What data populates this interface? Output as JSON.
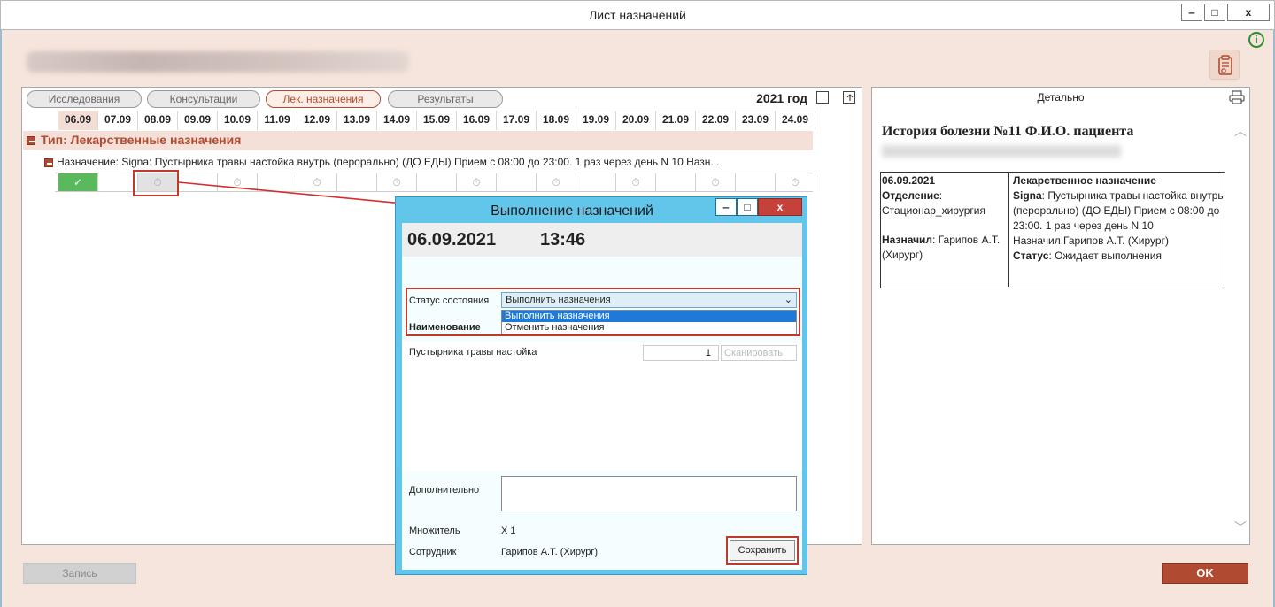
{
  "window": {
    "title": "Лист назначений",
    "controls": {
      "minimize": "‒",
      "maximize": "□",
      "close": "x"
    }
  },
  "tabs": [
    {
      "label": "Исследования",
      "active": false
    },
    {
      "label": "Консультации",
      "active": false
    },
    {
      "label": "Лек. назначения",
      "active": true
    },
    {
      "label": "Результаты",
      "active": false
    }
  ],
  "year_label": "2021 год",
  "dates": [
    "06.09",
    "07.09",
    "08.09",
    "09.09",
    "10.09",
    "11.09",
    "12.09",
    "13.09",
    "14.09",
    "15.09",
    "16.09",
    "17.09",
    "18.09",
    "19.09",
    "20.09",
    "21.09",
    "22.09",
    "23.09",
    "24.09"
  ],
  "selected_date": "06.09",
  "type_group": {
    "label": "Тип: Лекарственные назначения"
  },
  "assignment": {
    "text": "Назначение: Signa: Пустырника травы настойка  внутрь (перорально) (ДО ЕДЫ)   Прием с 08:00 до 23:00. 1 раз через день N 10 Назн...",
    "done_mark": "✓",
    "timer_glyph": "⏱"
  },
  "detail": {
    "header": "Детально",
    "history_title": "История болезни №11 Ф.И.О. пациента",
    "date": "06.09.2021",
    "department_label": "Отделение",
    "department_value": "Стационар_хирургия",
    "assigned_label": "Назначил",
    "assigned_value": "Гарипов А.Т. (Хирург)",
    "type_title": "Лекарственное назначение",
    "signa_label": "Signa",
    "signa_text": "Пустырника травы настойка внутрь (перорально) (ДО ЕДЫ) Прием с 08:00 до 23:00. 1 раз через день N 10 Назначил:Гарипов А.Т. (Хирург)",
    "status_label": "Статус",
    "status_value": "Ожидает выполнения"
  },
  "buttons": {
    "record": "Запись",
    "ok": "OK"
  },
  "dialog": {
    "title": "Выполнение назначений",
    "date": "06.09.2021",
    "time": "13:46",
    "status_label": "Статус состояния",
    "status_selected": "Выполнить назначения",
    "status_options": [
      "Выполнить назначения",
      "Отменить назначения"
    ],
    "name_label": "Наименование",
    "item_name": "Пустырника травы настойка",
    "quantity": "1",
    "scan_label": "Сканировать",
    "additional_label": "Дополнительно",
    "multiplier_label": "Множитель",
    "multiplier_value": "X 1",
    "employee_label": "Сотрудник",
    "employee_value": "Гарипов А.Т. (Хирург)",
    "save_label": "Сохранить"
  },
  "colors": {
    "accent": "#b04a30",
    "done": "#5cb85c",
    "dialog_frame": "#62c6ea",
    "highlight": "#1e7ad6"
  }
}
